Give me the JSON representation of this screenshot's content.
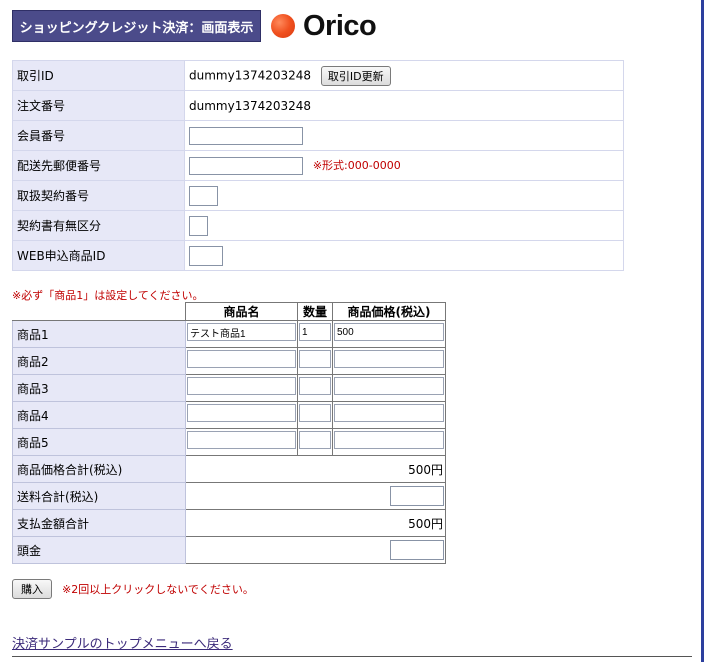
{
  "header": {
    "title": "ショッピングクレジット決済：画面表示",
    "logo_text": "Orico",
    "logo_color": "#f0501f"
  },
  "form": {
    "rows": [
      {
        "label": "取引ID",
        "value": "dummy1374203248",
        "button": "取引ID更新"
      },
      {
        "label": "注文番号",
        "value": "dummy1374203248"
      },
      {
        "label": "会員番号",
        "value": ""
      },
      {
        "label": "配送先郵便番号",
        "value": "",
        "note": "※形式:000-0000"
      },
      {
        "label": "取扱契約番号",
        "value": ""
      },
      {
        "label": "契約書有無区分",
        "value": ""
      },
      {
        "label": "WEB申込商品ID",
        "value": ""
      }
    ]
  },
  "goods": {
    "note": "※必ず「商品1」は設定してください。",
    "headers": [
      "商品名",
      "数量",
      "商品価格(税込)"
    ],
    "items": [
      {
        "label": "商品1",
        "name": "テスト商品1",
        "qty": "1",
        "price": "500"
      },
      {
        "label": "商品2",
        "name": "",
        "qty": "",
        "price": ""
      },
      {
        "label": "商品3",
        "name": "",
        "qty": "",
        "price": ""
      },
      {
        "label": "商品4",
        "name": "",
        "qty": "",
        "price": ""
      },
      {
        "label": "商品5",
        "name": "",
        "qty": "",
        "price": ""
      }
    ],
    "totals": {
      "subtotal_label": "商品価格合計(税込)",
      "subtotal": "500円",
      "shipping_label": "送料合計(税込)",
      "shipping": "",
      "payment_label": "支払金額合計",
      "payment": "500円",
      "deposit_label": "頭金",
      "deposit": ""
    }
  },
  "actions": {
    "buy_label": "購入",
    "buy_note": "※2回以上クリックしないでください。"
  },
  "footer": {
    "back_link": "決済サンプルのトップメニューへ戻る"
  }
}
